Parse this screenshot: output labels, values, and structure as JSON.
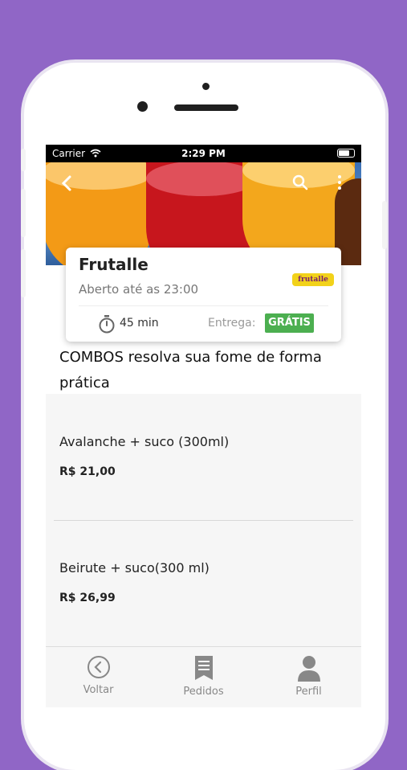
{
  "status_bar": {
    "carrier": "Carrier",
    "time": "2:29 PM"
  },
  "restaurant": {
    "name": "Frutalle",
    "hours": "Aberto até as 23:00",
    "logo_text": "frutalle",
    "delivery_time": "45 min",
    "delivery_label": "Entrega:",
    "delivery_fee": "GRÁTIS"
  },
  "section": {
    "title": "COMBOS resolva sua fome de forma prática"
  },
  "items": [
    {
      "name": "Avalanche + suco (300ml)",
      "price": "R$ 21,00"
    },
    {
      "name": "Beirute + suco(300 ml)",
      "price": "R$ 26,99"
    }
  ],
  "tabbar": {
    "back": "Voltar",
    "orders": "Pedidos",
    "profile": "Perfil"
  },
  "colors": {
    "background": "#9066c6",
    "badge": "#4caf50",
    "logo": "#f2d21a"
  }
}
